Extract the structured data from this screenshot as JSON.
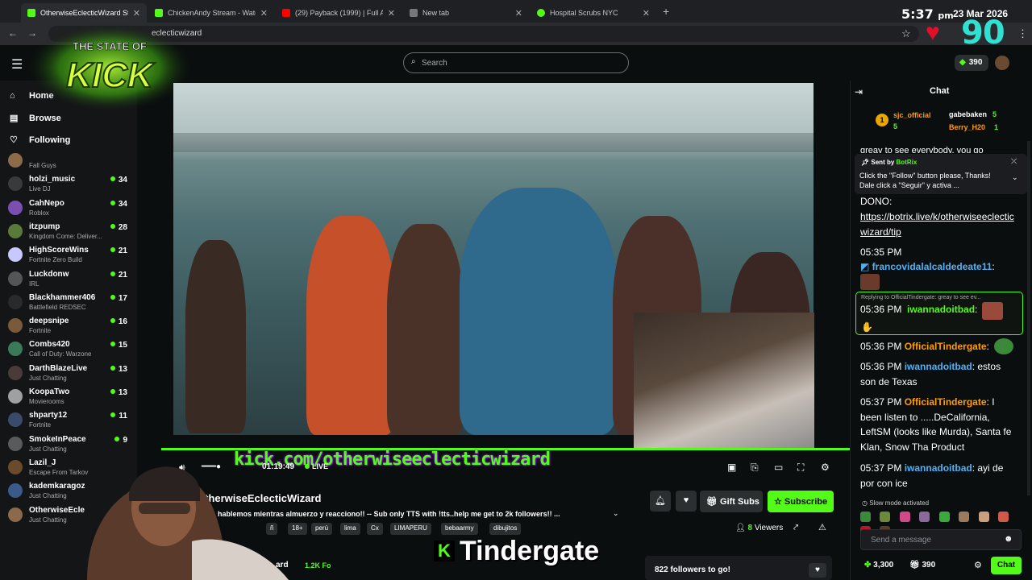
{
  "browser": {
    "tabs": [
      {
        "title": "OtherwiseEclecticWizard St",
        "active": true,
        "favicon_color": "#53fc18"
      },
      {
        "title": "ChickenAndy Stream - Watch Li",
        "active": false,
        "favicon_color": "#53fc18"
      },
      {
        "title": "(29) Payback (1999) | Full Actio",
        "active": false,
        "favicon_color": "#ff0000"
      },
      {
        "title": "New tab",
        "active": false,
        "favicon_color": "#aaaaaa"
      },
      {
        "title": "Hospital Scrubs NYC",
        "active": false,
        "favicon_color": "#53fc18"
      }
    ],
    "url": "eclecticwizard",
    "new_tab_icon": "+"
  },
  "overlay": {
    "time": "5:37",
    "ampm": "pm",
    "date": "23 Mar 2026",
    "big_number": "90",
    "logo_line1": "THE STATE OF",
    "logo_line2": "KICK",
    "url_banner": "kick.com/otherwiseeclecticwizard",
    "tindergate": "Tindergate",
    "tindergate_k": "K"
  },
  "header": {
    "search_placeholder": "Search",
    "points": "390"
  },
  "sidebar": {
    "nav": [
      {
        "label": "Home",
        "icon": "home-icon"
      },
      {
        "label": "Browse",
        "icon": "browse-icon"
      },
      {
        "label": "Following",
        "icon": "heart-icon"
      }
    ],
    "channels": [
      {
        "name": "",
        "game": "Fall Guys",
        "viewers": "",
        "color": "#8c6a4a"
      },
      {
        "name": "holzi_music",
        "game": "Live DJ",
        "viewers": "34",
        "color": "#3a3a3a"
      },
      {
        "name": "CahNepo",
        "game": "Roblox",
        "viewers": "34",
        "color": "#7a4fb0"
      },
      {
        "name": "itzpump",
        "game": "Kingdom Come: Deliver...",
        "viewers": "28",
        "color": "#5a7a3a"
      },
      {
        "name": "HighScoreWins",
        "game": "Fortnite Zero Build",
        "viewers": "21",
        "color": "#c8c8ff"
      },
      {
        "name": "Luckdonw",
        "game": "IRL",
        "viewers": "21",
        "color": "#555555"
      },
      {
        "name": "Blackhammer406",
        "game": "Battlefield REDSEC",
        "viewers": "17",
        "color": "#2a2a2a"
      },
      {
        "name": "deepsnipe",
        "game": "Fortnite",
        "viewers": "16",
        "color": "#7a5a3a"
      },
      {
        "name": "Combs420",
        "game": "Call of Duty: Warzone",
        "viewers": "15",
        "color": "#3a7a5a"
      },
      {
        "name": "DarthBlazeLive",
        "game": "Just Chatting",
        "viewers": "13",
        "color": "#4a3a3a"
      },
      {
        "name": "KoopaTwo",
        "game": "Movierooms",
        "viewers": "13",
        "color": "#a0a0a0"
      },
      {
        "name": "shparty12",
        "game": "Fortnite",
        "viewers": "11",
        "color": "#3a4a6a"
      },
      {
        "name": "SmokeInPeace",
        "game": "Just Chatting",
        "viewers": "9",
        "color": "#5a5a5a"
      },
      {
        "name": "Lazil_J",
        "game": "Escape From Tarkov",
        "viewers": "",
        "color": "#6a4a2a"
      },
      {
        "name": "kademkaragoz",
        "game": "Just Chatting",
        "viewers": "",
        "color": "#3a5a8a"
      },
      {
        "name": "OtherwiseEcle",
        "game": "Just Chatting",
        "viewers": "",
        "color": "#8a6a4a"
      }
    ]
  },
  "player": {
    "time": "01:19:49",
    "live": "LIVE"
  },
  "stream": {
    "streamer": "OtherwiseEclecticWizard",
    "title": "hablemos mientras almuerzo y reacciono!! -- Sub only TTS with !tts..help me get to 2k followers!!  ...",
    "tags": [
      "18+",
      "perú",
      "lima",
      "Cx",
      "LIMAPERU",
      "bebaarmy",
      "dibujitos"
    ],
    "tag_partial": "ñ",
    "viewers_count": "8",
    "viewers_label": "Viewers",
    "gift_subs": "Gift Subs",
    "subscribe": "Subscribe",
    "followers_to_go": "822 followers to go!",
    "follow_count": "1.2K Fo",
    "cut_name": "ard"
  },
  "chat": {
    "title": "Chat",
    "leaderboard": [
      {
        "name": "sjc_official",
        "count": "5",
        "rank": "1"
      },
      {
        "name": "gabebaken",
        "count": "5"
      },
      {
        "name": "Berry_H20",
        "count": "1"
      }
    ],
    "partial_line": "greay to see everybody, you go",
    "pinned": {
      "sent_by": "Sent by",
      "bot": "BotRix",
      "text": "Click the \"Follow\" button please, Thanks! Dale click a \"Seguir\" y activa ..."
    },
    "dono_label": "DONO:",
    "dono_link": "https://botrix.live/k/otherwiseeclecticwizard/tip",
    "messages": [
      {
        "ts": "05:35 PM",
        "user": "francovidalalcaldedeate11",
        "text": ":"
      },
      {
        "ts": "05:36 PM",
        "user": "iwannadoitbad",
        "text": ":",
        "reply": "Replying to OfficialTindergate: greay to see ev..."
      },
      {
        "ts": "05:36 PM",
        "user": "OfficialTindergate",
        "text": ":"
      },
      {
        "ts": "05:36 PM",
        "user": "iwannadoitbad",
        "text": ": estos son de Texas"
      },
      {
        "ts": "05:37 PM",
        "user": "OfficialTindergate",
        "text": ": I been listen to .....DeCalifornia, LeftSM (looks like Murda), Santa fe Klan, Snow Tha Product"
      },
      {
        "ts": "05:37 PM",
        "user": "iwannadoitbad",
        "text": ": ayi de por con ice"
      }
    ],
    "slow_mode": "Slow mode activated",
    "input_placeholder": "Send a message",
    "points": "3,300",
    "gift_count": "390",
    "send": "Chat"
  }
}
